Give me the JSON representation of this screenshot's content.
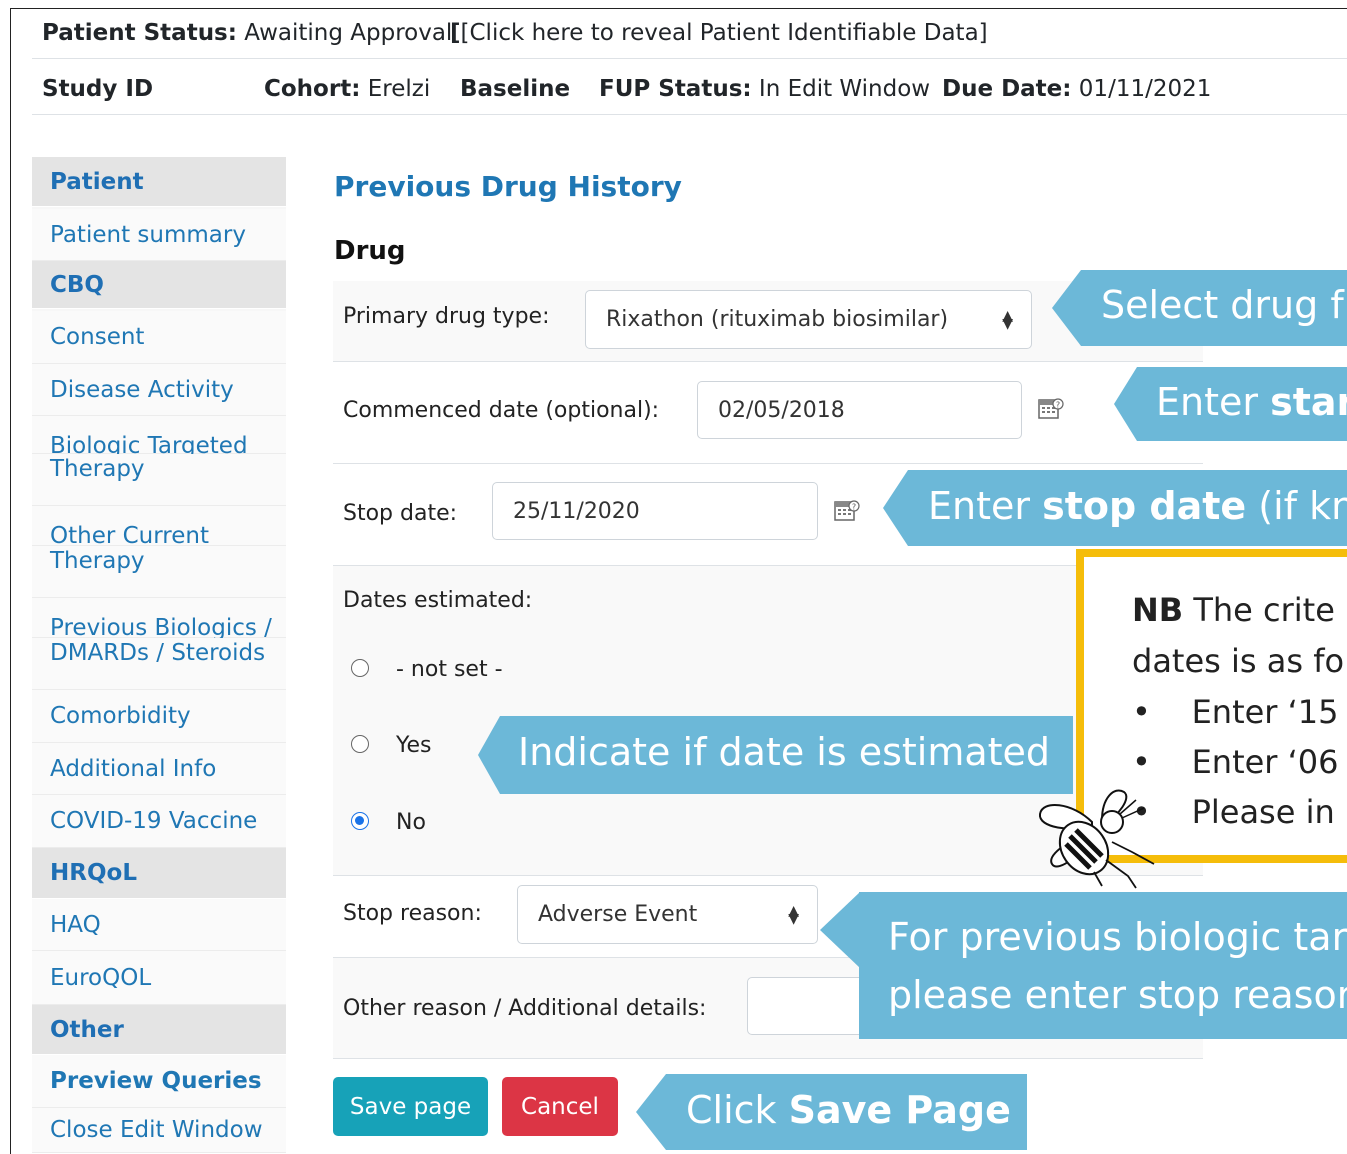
{
  "header": {
    "patient_status_label": "Patient Status:",
    "patient_status_value": "Awaiting Approval",
    "reveal_link": "[Click here to reveal Patient Identifiable Data]",
    "study_id_label": "Study ID",
    "cohort_label": "Cohort:",
    "cohort_value": "Erelzi",
    "baseline_label": "Baseline",
    "fup_label": "FUP Status:",
    "fup_value": "In Edit Window",
    "due_label": "Due Date:",
    "due_value": "01/11/2021"
  },
  "sidebar": {
    "items": [
      {
        "label": "Patient",
        "type": "heading"
      },
      {
        "label": "Patient summary",
        "type": "link"
      },
      {
        "label": "CBQ",
        "type": "heading"
      },
      {
        "label": "Consent",
        "type": "link"
      },
      {
        "label": "Disease Activity",
        "type": "link"
      },
      {
        "label": "Biologic Targeted",
        "type": "link"
      },
      {
        "label": "Therapy",
        "type": "link"
      },
      {
        "label": "Other Current",
        "type": "link"
      },
      {
        "label": "Therapy",
        "type": "link"
      },
      {
        "label": "Previous Biologics /",
        "type": "link"
      },
      {
        "label": "DMARDs / Steroids",
        "type": "link"
      },
      {
        "label": "Comorbidity",
        "type": "link"
      },
      {
        "label": "Additional Info",
        "type": "link"
      },
      {
        "label": "COVID-19 Vaccine",
        "type": "link"
      },
      {
        "label": "HRQoL",
        "type": "heading"
      },
      {
        "label": "HAQ",
        "type": "link"
      },
      {
        "label": "EuroQOL",
        "type": "link"
      },
      {
        "label": "Other",
        "type": "heading"
      },
      {
        "label": "Preview Queries",
        "type": "link"
      },
      {
        "label": "Close Edit Window",
        "type": "link"
      }
    ]
  },
  "form": {
    "title": "Previous Drug History",
    "section": "Drug",
    "primary_drug_label": "Primary drug type:",
    "primary_drug_value": "Rixathon (rituximab biosimilar)",
    "commenced_label": "Commenced date (optional):",
    "commenced_value": "02/05/2018",
    "stop_date_label": "Stop date:",
    "stop_date_value": "25/11/2020",
    "dates_estimated_label": "Dates estimated:",
    "radio_options": [
      "- not set -",
      "Yes",
      "No"
    ],
    "radio_selected": "No",
    "stop_reason_label": "Stop reason:",
    "stop_reason_value": "Adverse Event",
    "other_reason_label": "Other reason / Additional details:",
    "save_label": "Save page",
    "cancel_label": "Cancel"
  },
  "callouts": {
    "select_drug_pre": "Select drug f",
    "enter_start_pre": "Enter ",
    "enter_start_bold": "star",
    "enter_stop_pre": "Enter ",
    "enter_stop_bold": "stop date",
    "enter_stop_post": " (if kn",
    "indicate_estimated": "Indicate if date is estimated",
    "stop_reason_line1": "For previous biologic tar",
    "stop_reason_line2": "please enter stop reasor",
    "click_pre": "Click ",
    "click_bold": "Save Page"
  },
  "nb_box": {
    "nb_bold": "NB",
    "line1": " The crite",
    "line2": "dates is as fo",
    "bullets": [
      "Enter ‘15",
      "Enter ‘06",
      "Please in"
    ]
  },
  "colors": {
    "link_blue": "#1f77b4",
    "callout_blue": "#6cb8d8",
    "save_teal": "#17a2b8",
    "cancel_red": "#dc3545",
    "nb_border": "#f5bd0a",
    "radio_selected": "#1a73e8"
  },
  "icons": {
    "calendar": "calendar-icon",
    "select_caret": "sort-caret-icon",
    "bee_logo": "bee-logo"
  }
}
